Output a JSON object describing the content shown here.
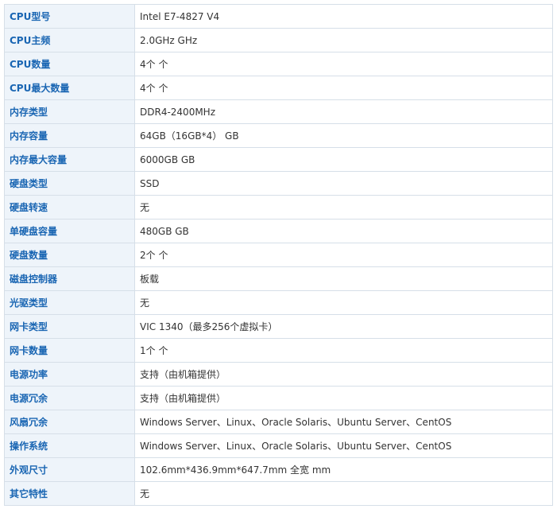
{
  "specs": [
    {
      "label": "CPU型号",
      "value": "Intel E7-4827 V4"
    },
    {
      "label": "CPU主频",
      "value": "2.0GHz  GHz"
    },
    {
      "label": "CPU数量",
      "value": "4个  个"
    },
    {
      "label": "CPU最大数量",
      "value": "4个  个"
    },
    {
      "label": "内存类型",
      "value": "DDR4-2400MHz"
    },
    {
      "label": "内存容量",
      "value": "64GB（16GB*4）  GB"
    },
    {
      "label": "内存最大容量",
      "value": "6000GB  GB"
    },
    {
      "label": "硬盘类型",
      "value": "SSD"
    },
    {
      "label": "硬盘转速",
      "value": "无"
    },
    {
      "label": "单硬盘容量",
      "value": "480GB  GB"
    },
    {
      "label": "硬盘数量",
      "value": "2个  个"
    },
    {
      "label": "磁盘控制器",
      "value": "板载"
    },
    {
      "label": "光驱类型",
      "value": "无"
    },
    {
      "label": "网卡类型",
      "value": "VIC 1340（最多256个虚拟卡）"
    },
    {
      "label": "网卡数量",
      "value": "1个  个"
    },
    {
      "label": "电源功率",
      "value": "支持（由机箱提供）"
    },
    {
      "label": "电源冗余",
      "value": "支持（由机箱提供）"
    },
    {
      "label": "风扇冗余",
      "value": "Windows Server、Linux、Oracle Solaris、Ubuntu Server、CentOS"
    },
    {
      "label": "操作系统",
      "value": "Windows Server、Linux、Oracle Solaris、Ubuntu Server、CentOS"
    },
    {
      "label": "外观尺寸",
      "value": "102.6mm*436.9mm*647.7mm 全宽  mm"
    },
    {
      "label": "其它特性",
      "value": "无"
    }
  ]
}
